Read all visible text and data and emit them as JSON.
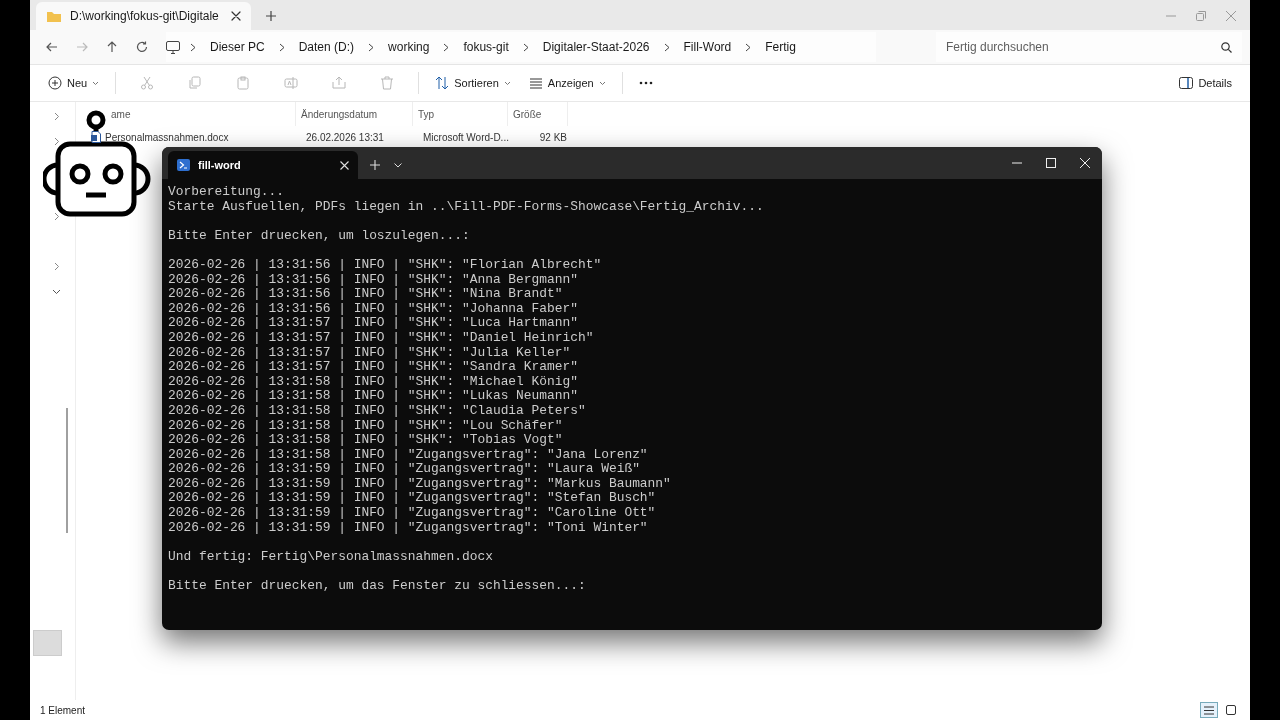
{
  "explorer": {
    "tab": {
      "title": "D:\\working\\fokus-git\\Digitale",
      "selected": true
    },
    "breadcrumb": [
      "Dieser PC",
      "Daten (D:)",
      "working",
      "fokus-git",
      "Digitaler-Staat-2026",
      "Fill-Word",
      "Fertig"
    ],
    "search": {
      "placeholder": "Fertig durchsuchen"
    },
    "toolbar": [
      {
        "kind": "new",
        "label": "Neu",
        "disabled": false
      },
      {
        "kind": "cut",
        "disabled": true
      },
      {
        "kind": "copy",
        "disabled": true
      },
      {
        "kind": "paste",
        "disabled": true
      },
      {
        "kind": "rename",
        "disabled": true
      },
      {
        "kind": "share",
        "disabled": true
      },
      {
        "kind": "delete",
        "disabled": true
      },
      {
        "kind": "sort",
        "label": "Sortieren",
        "disabled": false
      },
      {
        "kind": "view",
        "label": "Anzeigen",
        "disabled": false
      },
      {
        "kind": "more",
        "disabled": false
      }
    ],
    "details_button": "Details",
    "nav_rows": [
      {
        "kind": "toggle",
        "expanded": false
      },
      {
        "kind": "toggle",
        "expanded": false
      },
      {
        "kind": "empty"
      },
      {
        "kind": "empty"
      },
      {
        "kind": "toggle",
        "expanded": false
      },
      {
        "kind": "empty"
      },
      {
        "kind": "toggle",
        "expanded": false
      },
      {
        "kind": "toggle",
        "expanded": true
      }
    ],
    "columns": [
      "ame",
      "Änderungsdatum",
      "Typ",
      "Größe"
    ],
    "rows": [
      {
        "name": "Personalmassnahmen.docx",
        "date": "26.02.2026 13:31",
        "type": "Microsoft Word-D...",
        "size": "92 KB"
      }
    ],
    "status_bar": "1 Element",
    "view_modes": [
      {
        "kind": "details",
        "selected": true
      },
      {
        "kind": "tiles",
        "selected": false
      }
    ]
  },
  "terminal": {
    "tab_title": "fill-word",
    "blocks": [
      [
        "Vorbereitung...",
        "Starte Ausfuellen, PDFs liegen in ..\\Fill-PDF-Forms-Showcase\\Fertig_Archiv..."
      ],
      [
        "Bitte Enter druecken, um loszulegen...:"
      ],
      [
        "2026-02-26 | 13:31:56 | INFO | \"SHK\": \"Florian Albrecht\"",
        "2026-02-26 | 13:31:56 | INFO | \"SHK\": \"Anna Bergmann\"",
        "2026-02-26 | 13:31:56 | INFO | \"SHK\": \"Nina Brandt\"",
        "2026-02-26 | 13:31:56 | INFO | \"SHK\": \"Johanna Faber\"",
        "2026-02-26 | 13:31:57 | INFO | \"SHK\": \"Luca Hartmann\"",
        "2026-02-26 | 13:31:57 | INFO | \"SHK\": \"Daniel Heinrich\"",
        "2026-02-26 | 13:31:57 | INFO | \"SHK\": \"Julia Keller\"",
        "2026-02-26 | 13:31:57 | INFO | \"SHK\": \"Sandra Kramer\"",
        "2026-02-26 | 13:31:58 | INFO | \"SHK\": \"Michael König\"",
        "2026-02-26 | 13:31:58 | INFO | \"SHK\": \"Lukas Neumann\"",
        "2026-02-26 | 13:31:58 | INFO | \"SHK\": \"Claudia Peters\"",
        "2026-02-26 | 13:31:58 | INFO | \"SHK\": \"Lou Schäfer\"",
        "2026-02-26 | 13:31:58 | INFO | \"SHK\": \"Tobias Vogt\"",
        "2026-02-26 | 13:31:58 | INFO | \"Zugangsvertrag\": \"Jana Lorenz\"",
        "2026-02-26 | 13:31:59 | INFO | \"Zugangsvertrag\": \"Laura Weiß\"",
        "2026-02-26 | 13:31:59 | INFO | \"Zugangsvertrag\": \"Markus Baumann\"",
        "2026-02-26 | 13:31:59 | INFO | \"Zugangsvertrag\": \"Stefan Busch\"",
        "2026-02-26 | 13:31:59 | INFO | \"Zugangsvertrag\": \"Caroline Ott\"",
        "2026-02-26 | 13:31:59 | INFO | \"Zugangsvertrag\": \"Toni Winter\""
      ],
      [
        "Und fertig: Fertig\\Personalmassnahmen.docx"
      ],
      [
        "Bitte Enter druecken, um das Fenster zu schliessen...:"
      ]
    ]
  }
}
